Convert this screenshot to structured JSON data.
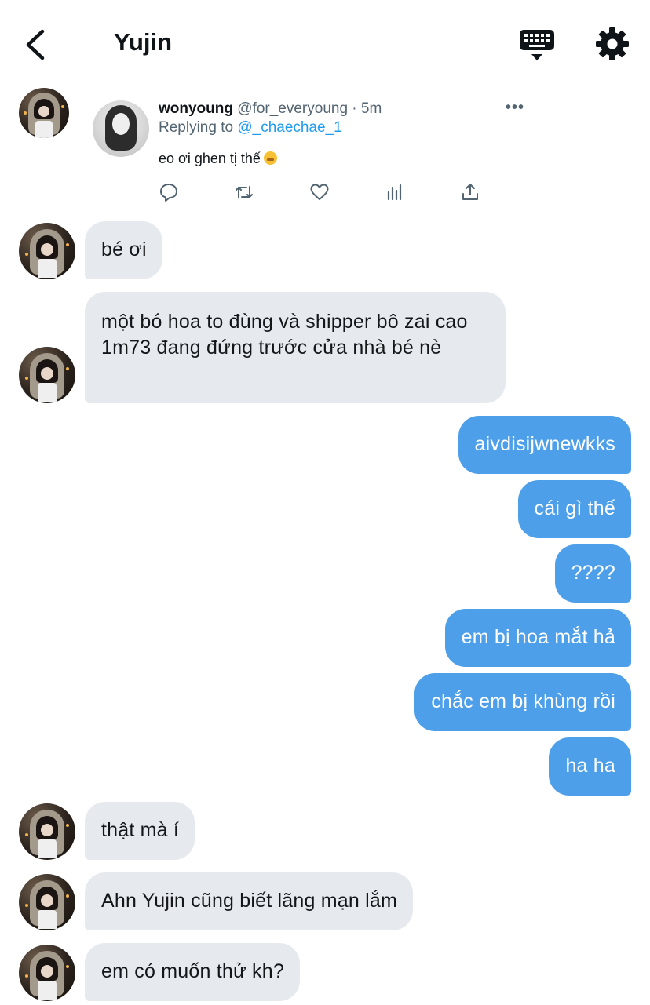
{
  "header": {
    "title": "Yujin"
  },
  "shared_tweet": {
    "author_name": "wonyoung",
    "author_handle": "@for_everyoung",
    "separator": " · ",
    "time": "5m",
    "more": "•••",
    "replying_prefix": "Replying to ",
    "replying_handle": "@_chaechae_1",
    "text": "eo ơi ghen tị thế",
    "emoji": "face-with-hand-over-mouth"
  },
  "messages": [
    {
      "from": "them",
      "text": "bé ơi"
    },
    {
      "from": "them",
      "text": "một bó hoa to đùng và shipper bô zai cao 1m73 đang đứng trước cửa nhà bé nè"
    },
    {
      "from": "me",
      "text": "aivdisijwnewkks"
    },
    {
      "from": "me",
      "text": "cái gì thế"
    },
    {
      "from": "me",
      "text": "????"
    },
    {
      "from": "me",
      "text": "em bị hoa mắt hả"
    },
    {
      "from": "me",
      "text": "chắc em bị khùng rồi"
    },
    {
      "from": "me",
      "text": "ha ha"
    },
    {
      "from": "them",
      "text": "thật mà í"
    },
    {
      "from": "them",
      "text": "Ahn Yujin cũng biết lãng mạn lắm"
    },
    {
      "from": "them",
      "text": "em có muốn thử kh?"
    }
  ],
  "colors": {
    "incoming_bubble": "#e6e9ee",
    "outgoing_bubble": "#4c9fe8",
    "link": "#1d9bf0",
    "meta": "#536471"
  }
}
